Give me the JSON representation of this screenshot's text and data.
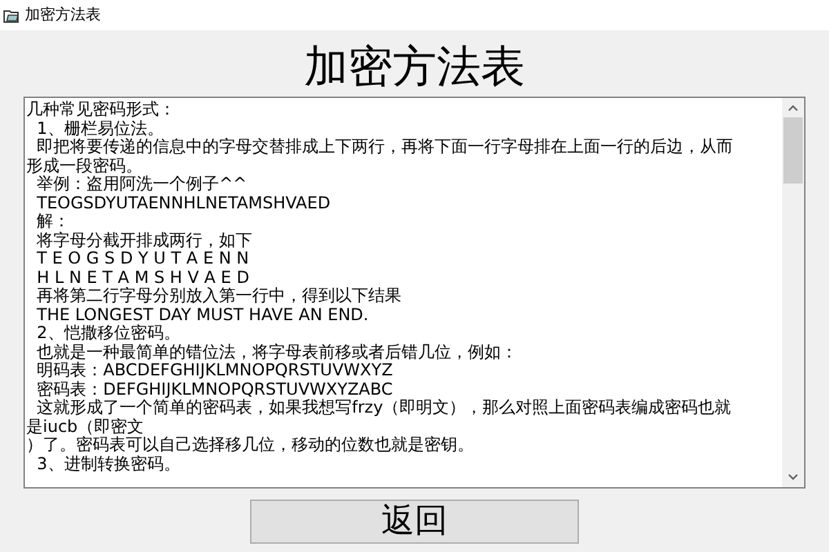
{
  "window": {
    "title": "加密方法表"
  },
  "heading": "加密方法表",
  "text_box": {
    "lines": [
      "几种常见密码形式：",
      "  1、栅栏易位法。",
      "  即把将要传递的信息中的字母交替排成上下两行，再将下面一行字母排在上面一行的后边，从而",
      "形成一段密码。",
      "  举例：盗用阿洗一个例子^^",
      "  TEOGSDYUTAENNHLNETAMSHVAED",
      "  解：",
      "  将字母分截开排成两行，如下",
      "  T E O G S D Y U T A E N N",
      "  H L N E T A M S H V A E D",
      "  再将第二行字母分别放入第一行中，得到以下结果",
      "  THE LONGEST DAY MUST HAVE AN END.",
      "  2、恺撒移位密码。",
      "  也就是一种最简单的错位法，将字母表前移或者后错几位，例如：",
      "  明码表：ABCDEFGHIJKLMNOPQRSTUVWXYZ",
      "  密码表：DEFGHIJKLMNOPQRSTUVWXYZABC",
      "  这就形成了一个简单的密码表，如果我想写frzy（即明文），那么对照上面密码表编成密码也就",
      "是iucb（即密文",
      "）了。密码表可以自己选择移几位，移动的位数也就是密钥。",
      "  3、进制转换密码。"
    ]
  },
  "buttons": [
    "返回"
  ]
}
